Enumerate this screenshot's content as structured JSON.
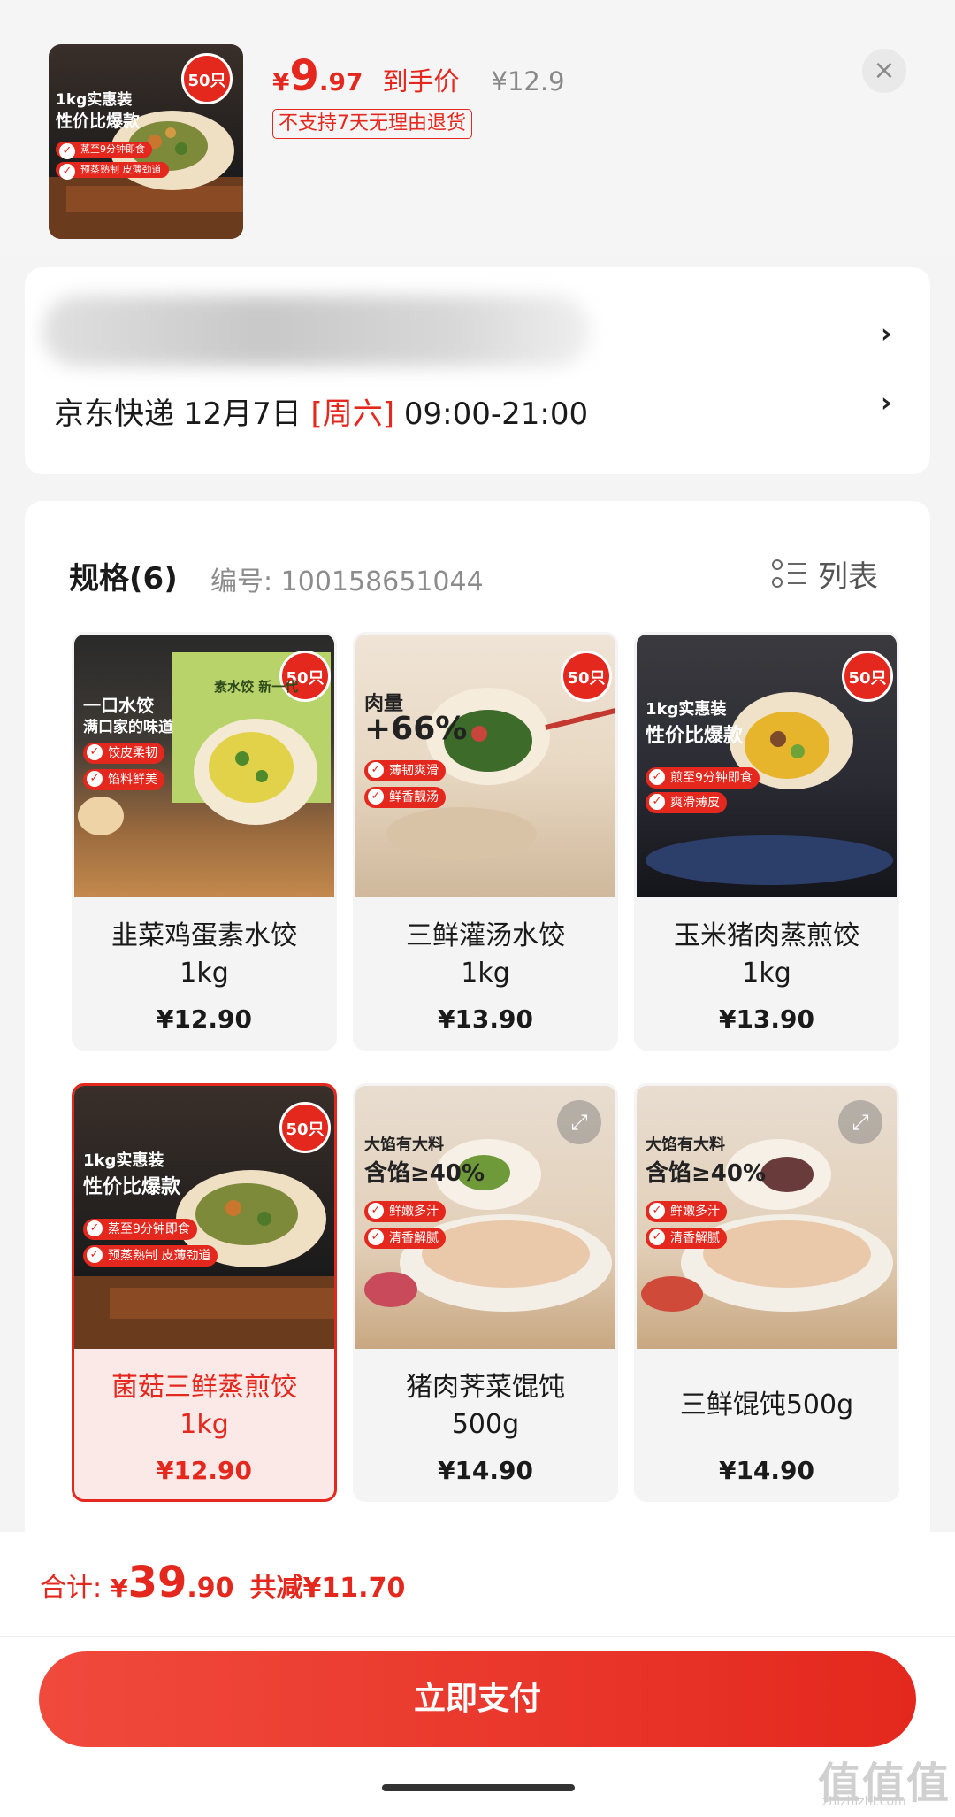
{
  "header": {
    "price_currency": "¥",
    "price_integer": "9",
    "price_decimal": ".97",
    "price_tag": "到手价",
    "original_price": "¥12.9",
    "return_policy": "不支持7天无理由退货",
    "close_label": "×"
  },
  "delivery": {
    "courier_and_date": "京东快递 12月7日 ",
    "weekday": "[周六]",
    "time_window": " 09:00-21:00"
  },
  "spec": {
    "title": "规格(6)",
    "id_label": "编号: 100158651044",
    "list_label": "列表"
  },
  "variants": [
    {
      "name": "韭菜鸡蛋素水饺\n1kg",
      "price": "¥12.90",
      "selected": false,
      "img": {
        "title": "一口水饺",
        "sub": "满口家的味道",
        "p1": "饺皮柔韧",
        "p2": "馅料鲜美",
        "badge": "50只",
        "side": "素水饺 新一代"
      }
    },
    {
      "name": "三鲜灌汤水饺\n1kg",
      "price": "¥13.90",
      "selected": false,
      "img": {
        "title": "肉量",
        "sub": "+66%",
        "p1": "薄韧爽滑",
        "p2": "鲜香靓汤",
        "badge": "50只"
      }
    },
    {
      "name": "玉米猪肉蒸煎饺\n1kg",
      "price": "¥13.90",
      "selected": false,
      "img": {
        "title": "1kg实惠装",
        "sub": "性价比爆款",
        "p1": "煎至9分钟即食",
        "p2": "爽滑薄皮",
        "badge": "50只"
      }
    },
    {
      "name": "菌菇三鲜蒸煎饺\n1kg",
      "price": "¥12.90",
      "selected": true,
      "img": {
        "title": "1kg实惠装",
        "sub": "性价比爆款",
        "p1": "蒸至9分钟即食",
        "p2": "预蒸熟制 皮薄劲道",
        "badge": "50只"
      }
    },
    {
      "name": "猪肉荠菜馄饨\n500g",
      "price": "¥14.90",
      "selected": false,
      "img": {
        "title": "大馅有大料",
        "sub": "含馅≥40%",
        "p1": "鲜嫩多汁",
        "p2": "清香解腻",
        "badge": ""
      }
    },
    {
      "name": "三鲜馄饨500g",
      "price": "¥14.90",
      "selected": false,
      "img": {
        "title": "大馅有大料",
        "sub": "含馅≥40%",
        "p1": "鲜嫩多汁",
        "p2": "清香解腻",
        "badge": ""
      }
    }
  ],
  "footer": {
    "total_label": "合计:",
    "total_currency": "¥",
    "total_integer": "39",
    "total_decimal": ".90",
    "discount": "共减¥11.70",
    "pay_button": "立即支付"
  },
  "thumb": {
    "title": "1kg实惠装",
    "sub": "性价比爆款",
    "p1": "蒸至9分钟即食",
    "p2": "预蒸熟制 皮薄劲道",
    "badge": "50只"
  },
  "watermark": {
    "logo": "值值值",
    "url": "zhizhizhi.com"
  },
  "colors": {
    "accent": "#e4281e",
    "background": "#f4f4f4"
  }
}
